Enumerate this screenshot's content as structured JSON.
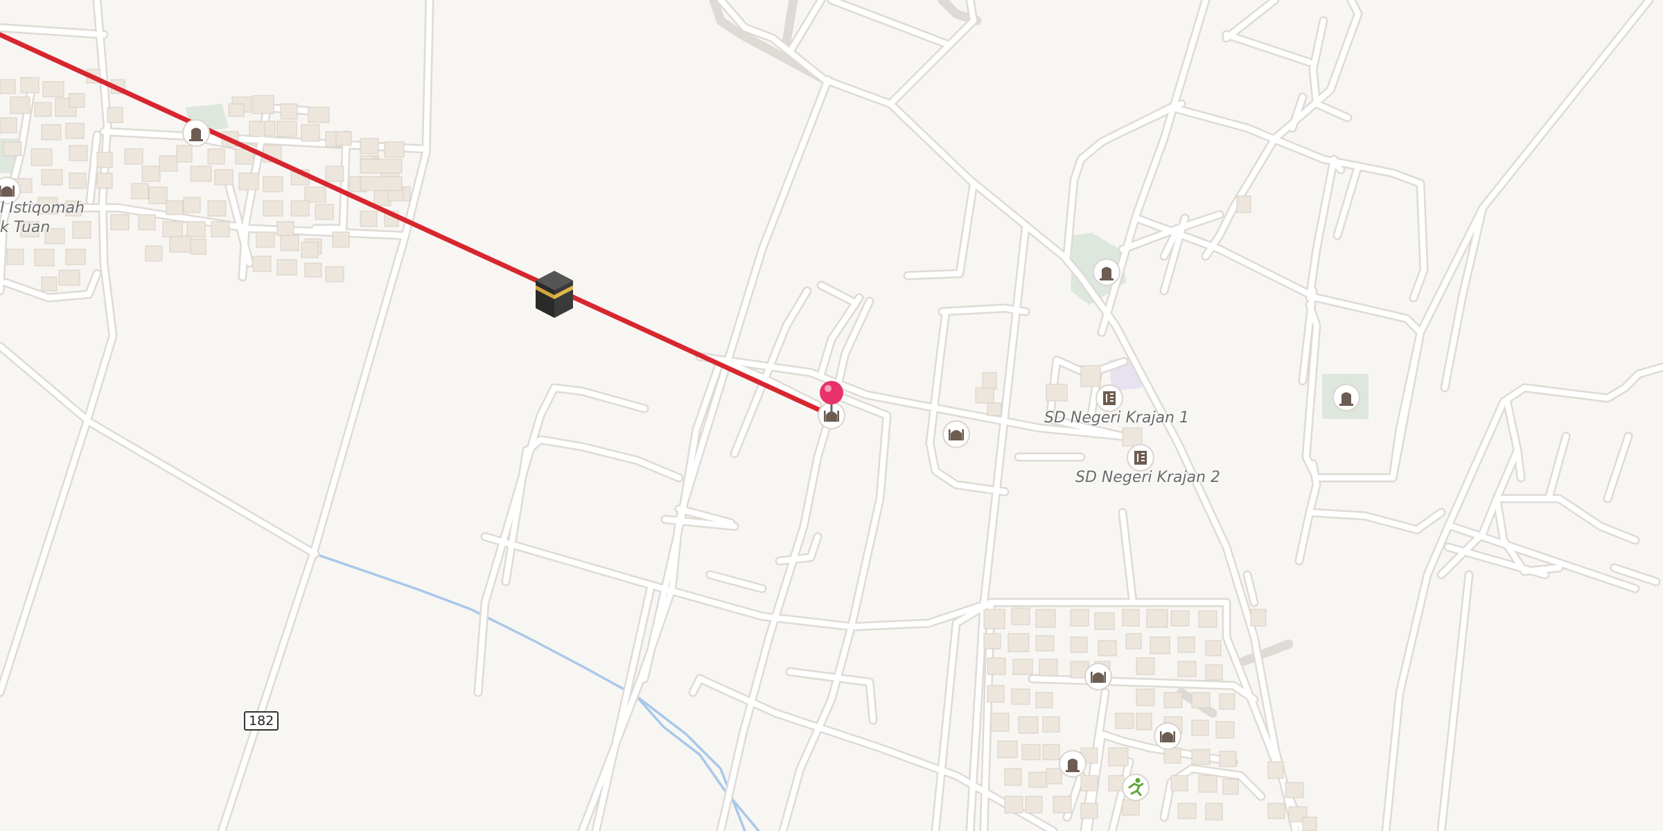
{
  "map": {
    "labels": {
      "place_istiqomah": "l Istiqomah",
      "place_tuan": "k Tuan",
      "school_krajan_1": "SD Negeri Krajan 1",
      "school_krajan_2": "SD Negeri Krajan 2"
    },
    "road_shield": "182",
    "colors": {
      "background": "#f8f6f3",
      "road_fill": "#ffffff",
      "road_casing": "#dedad5",
      "building": "#ede6dd",
      "waterway": "#a8c8ea",
      "qibla_line": "#d7262f",
      "location_pin": "#e8336a",
      "poi_icon": "#6d5c52",
      "park": "#dde7dd"
    },
    "icons": {
      "qibla_target": "kaaba-icon",
      "location": "location-pin-icon",
      "mosque": "mosque-icon",
      "cemetery": "cemetery-icon",
      "school": "school-icon",
      "sports": "sports-running-icon"
    }
  }
}
